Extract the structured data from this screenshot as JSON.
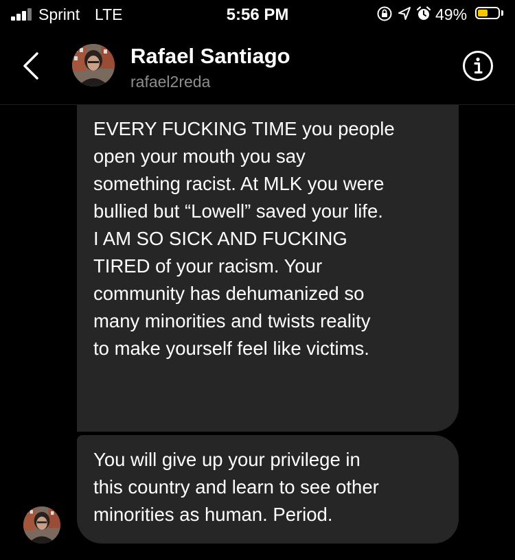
{
  "status_bar": {
    "carrier": "Sprint",
    "network": "LTE",
    "time": "5:56 PM",
    "battery_percent": "49%",
    "battery_level": 0.49,
    "battery_color": "#f7c600",
    "icons": [
      "signal-bars-icon",
      "orientation-lock-icon",
      "location-arrow-icon",
      "alarm-icon",
      "battery-icon"
    ]
  },
  "header": {
    "name": "Rafael Santiago",
    "username": "rafael2reda",
    "icons": [
      "back-chevron-icon",
      "info-icon"
    ]
  },
  "messages": [
    {
      "text": "EVERY FUCKING TIME you people\nopen your mouth you say\nsomething racist. At MLK you were\nbullied but “Lowell” saved your life.\nI AM SO SICK AND FUCKING\nTIRED of your racism. Your\ncommunity has dehumanized so\nmany minorities and twists reality\nto make yourself feel like victims."
    },
    {
      "text": "You will give up your privilege in\nthis country and learn to see other\nminorities as human. Period."
    }
  ],
  "colors": {
    "background": "#000000",
    "bubble": "#262626",
    "secondary_text": "#8e8e8e"
  }
}
